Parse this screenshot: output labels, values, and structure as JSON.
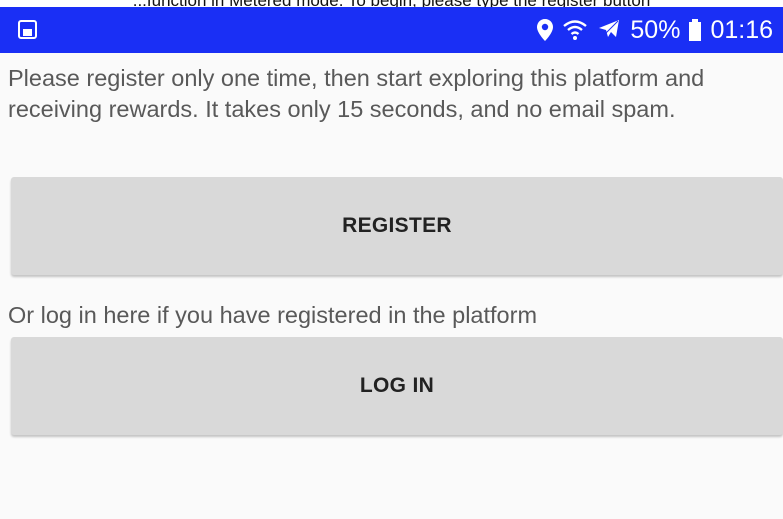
{
  "caption": {
    "text": "...function in Metered mode. To begin, please type the register button"
  },
  "status_bar": {
    "left_icon": "screen-mirror-icon",
    "location_icon": "location-pin-icon",
    "wifi_icon": "wifi-icon",
    "airplane_icon": "airplane-icon",
    "battery_percent": "50%",
    "battery_icon": "battery-icon",
    "time": "01:16",
    "color": "#1a2ff5"
  },
  "main": {
    "intro": "Please register only one time, then start exploring this platform and receiving rewards. It takes only 15 seconds, and no email spam.",
    "register_button": "REGISTER",
    "login_prompt": "Or log in here if you have registered in the platform",
    "login_button": "LOG IN"
  }
}
